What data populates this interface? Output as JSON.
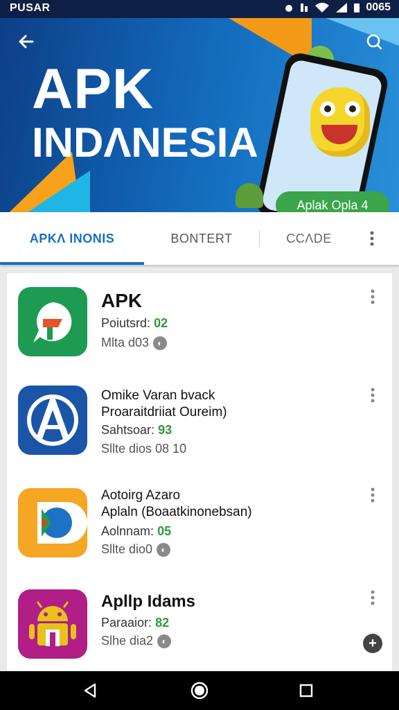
{
  "status_bar": {
    "carrier": "PUSAR",
    "time": "0065"
  },
  "hero": {
    "title_line1": "APK",
    "title_line2": "INDΛNESIA",
    "badge_label": "Aplak Opla 4"
  },
  "tabs": [
    {
      "label": "APKΛ INONIS"
    },
    {
      "label": "BONTERT"
    },
    {
      "label": "CCΛDE"
    }
  ],
  "apps": [
    {
      "name": "APK",
      "line1_label": "Poiutsrd:",
      "line1_value": "02",
      "line2_label": "Mlta d03",
      "icon": "green-map-icon"
    },
    {
      "name": "Omike Varan bvack",
      "name2": "Proaraitdriiat Oureim)",
      "line1_label": "Sahtsoar:",
      "line1_value": "93",
      "line2_label": "Sllte dios 08 10",
      "icon": "blue-a-icon"
    },
    {
      "name": "Aotoirg Azaro",
      "name2": "Aplaln (Boaatkinonebsan)",
      "line1_label": "Aolnnam:",
      "line1_value": "05",
      "line2_label": "Sllte dio0",
      "icon": "yellow-circle-icon"
    },
    {
      "name": "Apllp Idams",
      "line1_label": "Paraaior:",
      "line1_value": "82",
      "line2_label": "Slhe dia2",
      "icon": "android-icon"
    }
  ],
  "colors": {
    "accent": "#1670c4",
    "green": "#2e9a3a"
  }
}
